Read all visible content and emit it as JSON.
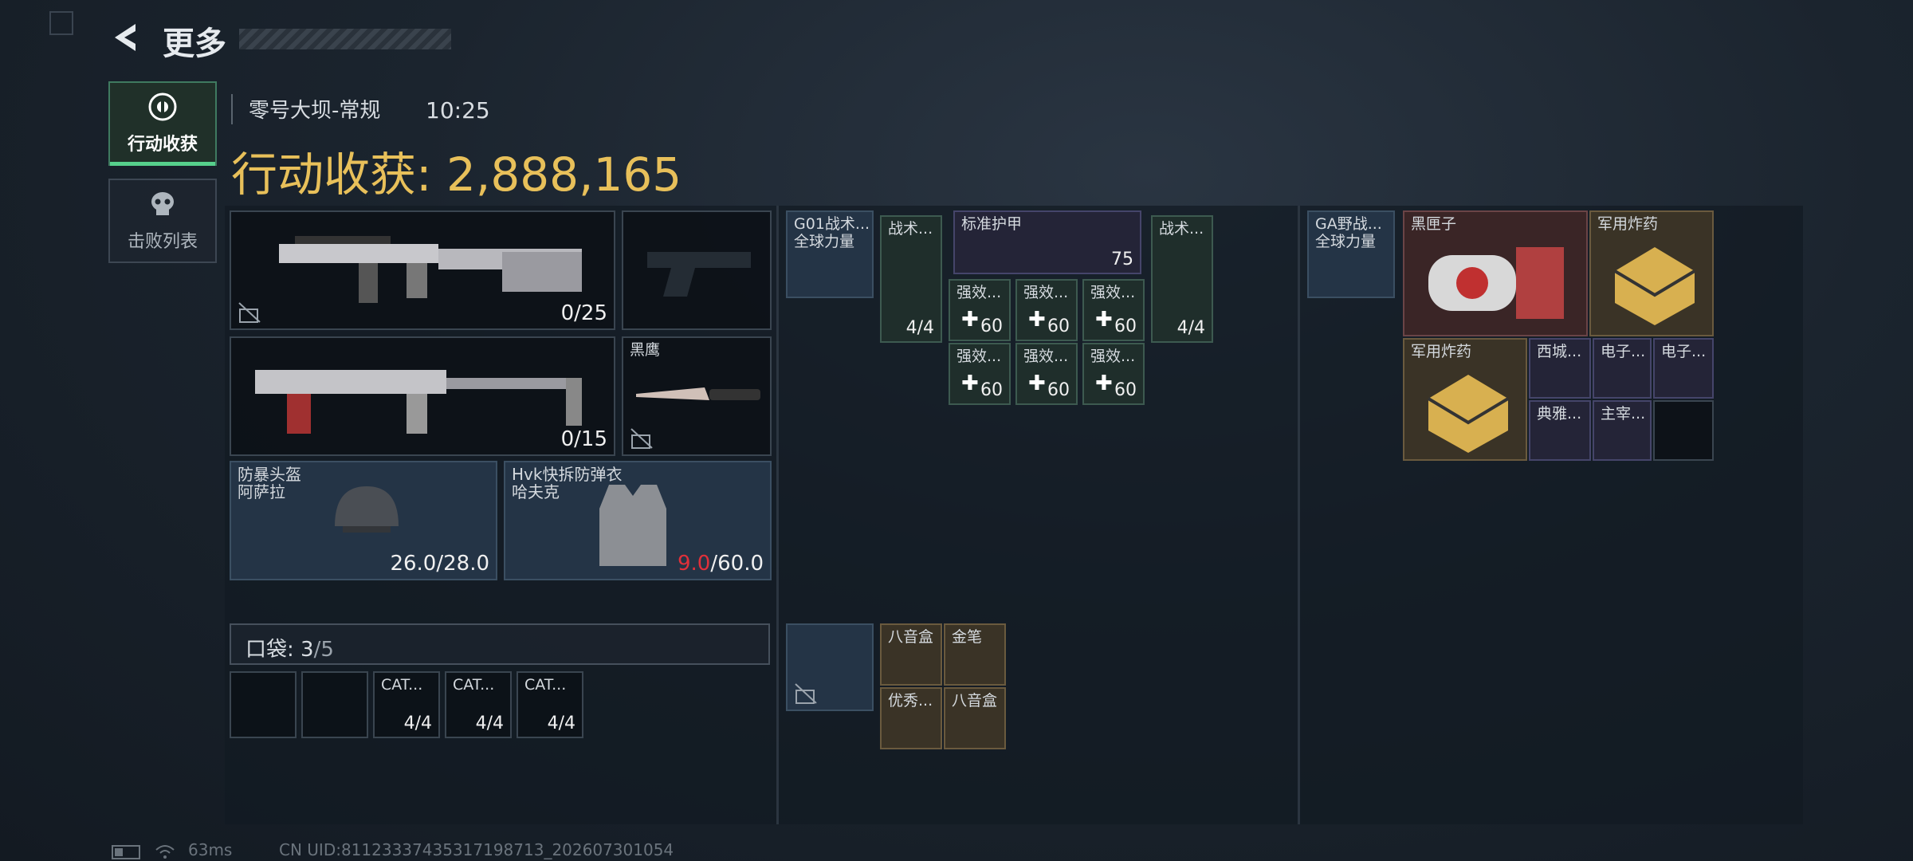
{
  "header": {
    "title": "更多"
  },
  "side_tabs": [
    {
      "label": "行动收获"
    },
    {
      "label": "击败列表"
    }
  ],
  "match": {
    "map": "零号大坝-常规",
    "time": "10:25"
  },
  "gain": {
    "label": "行动收获:",
    "value": "2,888,165"
  },
  "weapons": {
    "rifle_count": "0/25",
    "smg_count": "0/15",
    "knife_name": "黑鹰"
  },
  "armor": {
    "helmet": {
      "name": "防暴头盔",
      "brand": "阿萨拉",
      "durability": "26.0/28.0"
    },
    "vest": {
      "name": "Hvk快拆防弹衣",
      "brand": "哈夫克",
      "dur_current": "9.0",
      "dur_max": "/60.0"
    }
  },
  "pocket": {
    "label": "口袋:",
    "used": "3",
    "total": "/5",
    "items": [
      {
        "name": "CAT...",
        "count": "4/4"
      },
      {
        "name": "CAT...",
        "count": "4/4"
      },
      {
        "name": "CAT...",
        "count": "4/4"
      }
    ]
  },
  "chest_rig": {
    "name": "G01战术...",
    "sub": "全球力量",
    "medkit1": {
      "name": "战术...",
      "count": "4/4"
    },
    "armor_std": {
      "name": "标准护甲",
      "value": "75"
    },
    "medkit2": {
      "name": "战术...",
      "count": "4/4"
    },
    "syringes": [
      {
        "name": "强效...",
        "value": "60"
      },
      {
        "name": "强效...",
        "value": "60"
      },
      {
        "name": "强效...",
        "value": "60"
      },
      {
        "name": "强效...",
        "value": "60"
      },
      {
        "name": "强效...",
        "value": "60"
      },
      {
        "name": "强效...",
        "value": "60"
      }
    ]
  },
  "pouch": {
    "items": [
      {
        "name": "八音盒"
      },
      {
        "name": "金笔"
      },
      {
        "name": "优秀..."
      },
      {
        "name": "八音盒"
      }
    ]
  },
  "backpack": {
    "name": "GA野战...",
    "sub": "全球力量",
    "items": [
      {
        "name": "黑匣子"
      },
      {
        "name": "军用炸药"
      },
      {
        "name": "军用炸药"
      },
      {
        "name": "西城..."
      },
      {
        "name": "电子..."
      },
      {
        "name": "电子..."
      },
      {
        "name": "典雅..."
      },
      {
        "name": "主宰..."
      }
    ]
  },
  "status": {
    "ping": "63ms",
    "uid": "CN UID:8112333743531719871​3_202607301054"
  },
  "colors": {
    "gold": "#e8c05a",
    "accent_green": "#56d08c",
    "danger": "#e0303a"
  }
}
